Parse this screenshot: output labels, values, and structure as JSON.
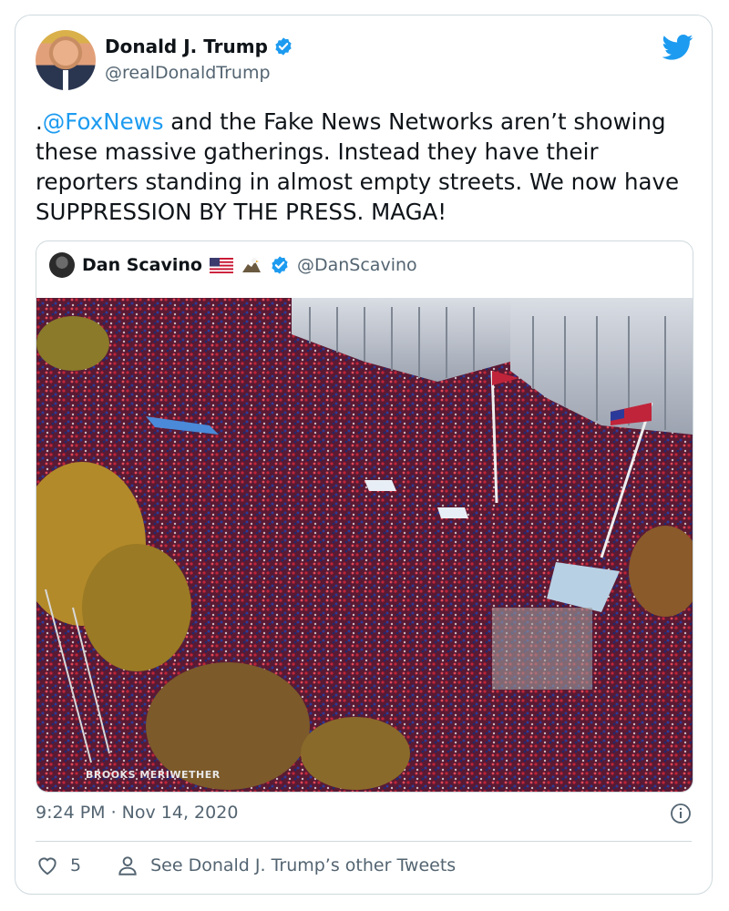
{
  "author": {
    "name": "Donald J. Trump",
    "handle": "@realDonaldTrump"
  },
  "tweet": {
    "prefix": ".",
    "mention": "@FoxNews",
    "body": " and the Fake News Networks aren’t showing these massive gatherings. Instead they have their reporters standing in almost empty streets. We now have SUPPRESSION BY THE PRESS. MAGA!"
  },
  "quoted": {
    "name": "Dan Scavino",
    "handle": "@DanScavino",
    "photo_watermark": "BROOKS MERIWETHER"
  },
  "meta": {
    "timestamp": "9:24 PM · Nov 14, 2020"
  },
  "actions": {
    "like_count": "5",
    "other_tweets_label": "See Donald J. Trump’s other Tweets"
  },
  "colors": {
    "accent": "#1d9bf0",
    "secondary_text": "#536471",
    "border": "#cfd9de"
  },
  "icons": [
    "verified-badge-icon",
    "twitter-bird-icon",
    "us-flag-icon",
    "eagle-icon",
    "info-icon",
    "heart-icon",
    "person-icon"
  ]
}
